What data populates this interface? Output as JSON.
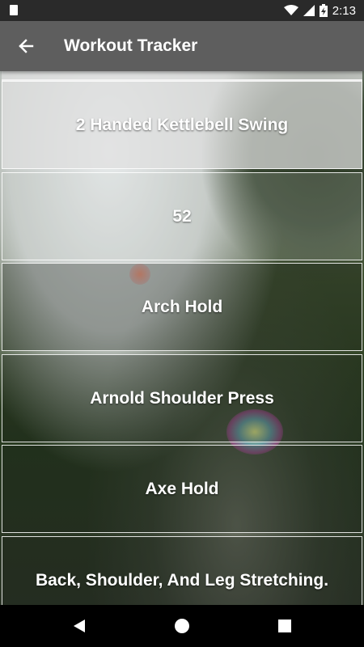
{
  "status_bar": {
    "time": "2:13",
    "icons": [
      "sd-card-icon",
      "wifi-icon",
      "cellular-icon",
      "battery-charging-icon"
    ]
  },
  "app_bar": {
    "title": "Workout Tracker",
    "back_icon": "arrow-left-icon"
  },
  "exercises": [
    "2 Handed Kettlebell Swing",
    "52",
    "Arch Hold",
    "Arnold Shoulder Press",
    "Axe Hold",
    "Back, Shoulder, And Leg Stretching."
  ],
  "nav_bar": {
    "icons": [
      "back-triangle-icon",
      "home-circle-icon",
      "overview-square-icon"
    ]
  },
  "colors": {
    "status_bar": "#2a2a2a",
    "app_bar": "#5e5e5e",
    "nav_bar": "#000000",
    "text": "#ffffff"
  }
}
